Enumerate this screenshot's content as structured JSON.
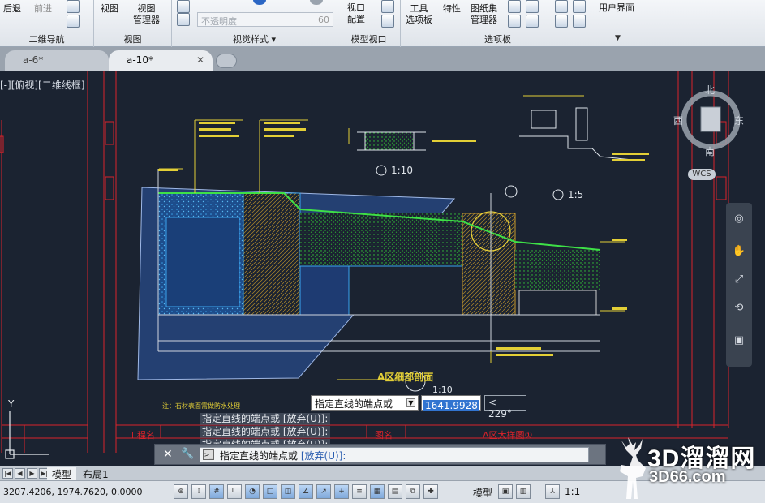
{
  "ribbon": {
    "back_label": "后退",
    "forward_label": "前进",
    "view_label": "视图",
    "view_manager_label": "视图\n管理器",
    "opacity_placeholder": "不透明度",
    "opacity_value": "60",
    "viewport_config_label": "视口\n配置",
    "tools_palette_label": "工具\n选项板",
    "properties_label": "特性",
    "sheetset_label": "图纸集\n管理器",
    "user_interface_label": "用户界面",
    "groups": {
      "nav2d": "二维导航",
      "view": "视图",
      "visual_styles": "视觉样式",
      "model_viewports": "模型视口",
      "palettes": "选项板"
    }
  },
  "tabs": [
    {
      "label": "a-6*",
      "active": false
    },
    {
      "label": "a-10*",
      "active": true
    }
  ],
  "viewport": {
    "label": "[-][俯视][二维线框]"
  },
  "viewcube": {
    "north": "北",
    "south": "南",
    "east": "东",
    "west": "西",
    "wcs": "WCS"
  },
  "drawing": {
    "section_title": "A区细部剖面",
    "section_scale": "1:10",
    "detail1_label": "1:10",
    "detail2_label": "1:5",
    "project_name_label": "工程名",
    "drawing_name_label": "图名",
    "drawing_title": "A区大样图①",
    "note": "注：石材表面需做防水处理"
  },
  "dynamic_input": {
    "prompt": "指定直线的端点或",
    "length_value": "1641.9928",
    "angle_value": "< 229°"
  },
  "command_history": [
    "指定直线的端点或 [放弃(U)]:",
    "指定直线的端点或 [放弃(U)]:",
    "指定直线的端点或 [放弃(U)]:"
  ],
  "command_line": {
    "prompt": "指定直线的端点或",
    "options": "[放弃(U)]:"
  },
  "layout_tabs": [
    {
      "label": "模型",
      "active": true
    },
    {
      "label": "布局1",
      "active": false
    }
  ],
  "status": {
    "coordinates": "3207.4206, 1974.7620, 0.0000",
    "model_label": "模型",
    "annotation_scale": "1:1"
  },
  "watermark": {
    "brand": "3D溜溜网",
    "url": "3D66.com"
  }
}
